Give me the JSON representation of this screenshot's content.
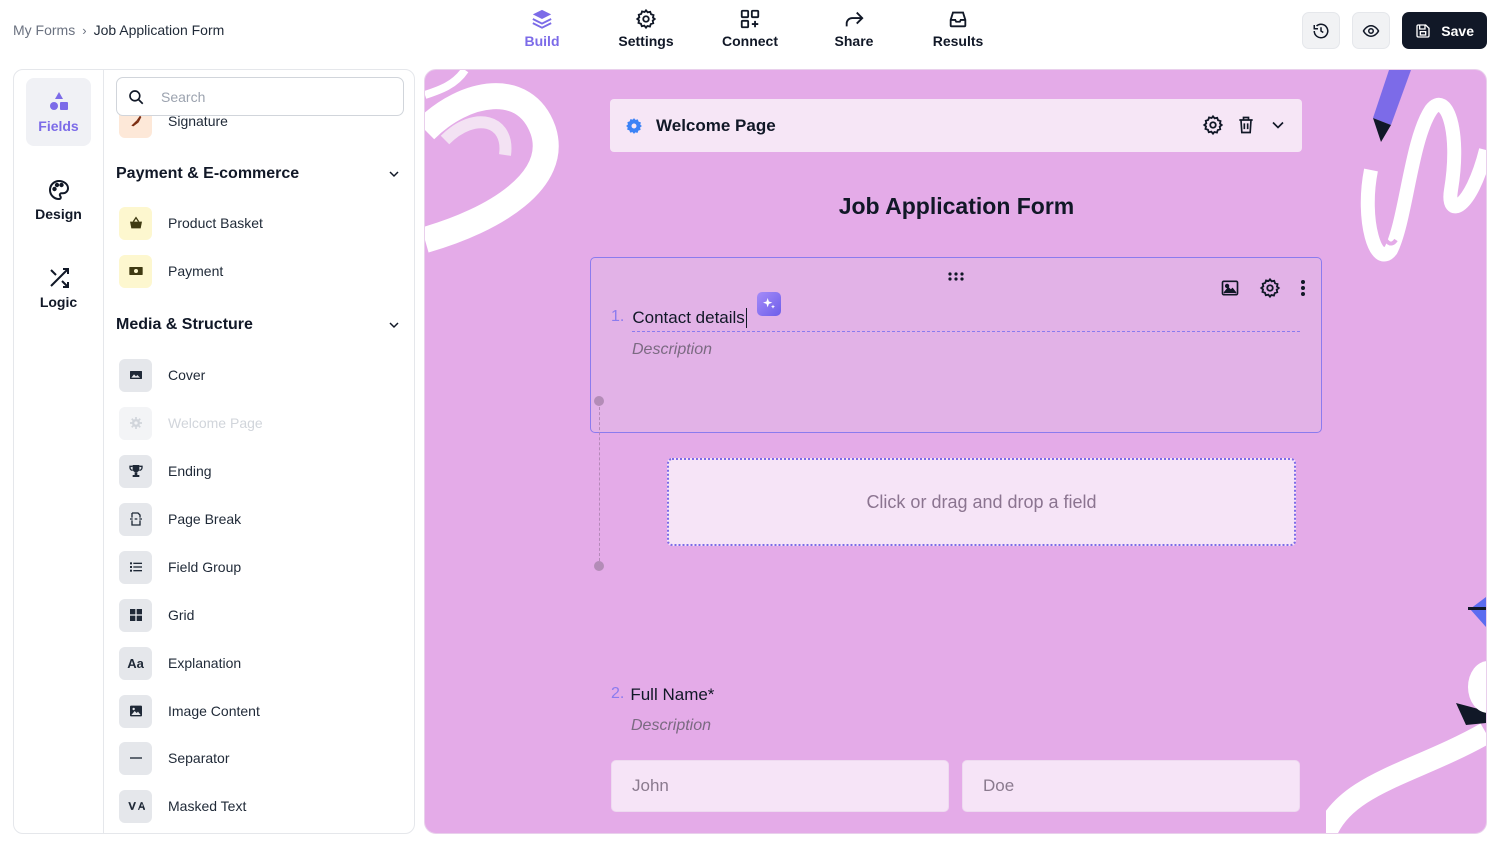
{
  "breadcrumb": {
    "root": "My Forms",
    "separator": "›",
    "current": "Job Application Form"
  },
  "topnav": [
    {
      "label": "Build",
      "icon": "layers-icon",
      "active": true
    },
    {
      "label": "Settings",
      "icon": "gear-icon"
    },
    {
      "label": "Connect",
      "icon": "grid-plus-icon"
    },
    {
      "label": "Share",
      "icon": "share-arrow-icon"
    },
    {
      "label": "Results",
      "icon": "inbox-icon"
    }
  ],
  "actions": {
    "history_icon": "history-icon",
    "preview_icon": "eye-icon",
    "save_label": "Save"
  },
  "rail": [
    {
      "label": "Fields",
      "icon": "shapes-icon",
      "active": true
    },
    {
      "label": "Design",
      "icon": "palette-icon"
    },
    {
      "label": "Logic",
      "icon": "shuffle-icon"
    }
  ],
  "search": {
    "placeholder": "Search"
  },
  "fields": {
    "partial_item": "Signature",
    "sections": [
      {
        "title": "Payment & E-commerce",
        "items": [
          "Product Basket",
          "Payment"
        ]
      },
      {
        "title": "Media & Structure",
        "items": [
          "Cover",
          "Welcome Page",
          "Ending",
          "Page Break",
          "Field Group",
          "Grid",
          "Explanation",
          "Image Content",
          "Separator",
          "Masked Text"
        ]
      }
    ],
    "disabled_item": "Welcome Page"
  },
  "canvas": {
    "background": "#e4abe8",
    "accent": "#7c6be8",
    "welcome_title": "Welcome Page",
    "form_title": "Job Application Form",
    "questions": [
      {
        "number": "1.",
        "label": "Contact details",
        "description": "Description"
      },
      {
        "number": "2.",
        "label": "Full Name*",
        "description": "Description"
      }
    ],
    "drop_zone": "Click or drag and drop a field",
    "name_fields": {
      "first": "John",
      "last": "Doe"
    }
  }
}
